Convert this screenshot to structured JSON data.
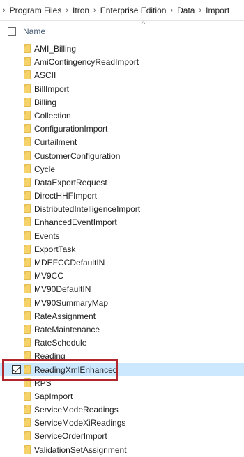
{
  "breadcrumb": {
    "items": [
      "Program Files",
      "Itron",
      "Enterprise Edition",
      "Data",
      "Import"
    ],
    "separator": "›"
  },
  "header": {
    "name_label": "Name",
    "sort_indicator": "^"
  },
  "folders": [
    {
      "label": "AMI_Billing",
      "selected": false
    },
    {
      "label": "AmiContingencyReadImport",
      "selected": false
    },
    {
      "label": "ASCII",
      "selected": false
    },
    {
      "label": "BillImport",
      "selected": false
    },
    {
      "label": "Billing",
      "selected": false
    },
    {
      "label": "Collection",
      "selected": false
    },
    {
      "label": "ConfigurationImport",
      "selected": false
    },
    {
      "label": "Curtailment",
      "selected": false
    },
    {
      "label": "CustomerConfiguration",
      "selected": false
    },
    {
      "label": "Cycle",
      "selected": false
    },
    {
      "label": "DataExportRequest",
      "selected": false
    },
    {
      "label": "DirectHHFImport",
      "selected": false
    },
    {
      "label": "DistributedIntelligenceImport",
      "selected": false
    },
    {
      "label": "EnhancedEventImport",
      "selected": false
    },
    {
      "label": "Events",
      "selected": false
    },
    {
      "label": "ExportTask",
      "selected": false
    },
    {
      "label": "MDEFCCDefaultIN",
      "selected": false
    },
    {
      "label": "MV9CC",
      "selected": false
    },
    {
      "label": "MV90DefaultIN",
      "selected": false
    },
    {
      "label": "MV90SummaryMap",
      "selected": false
    },
    {
      "label": "RateAssignment",
      "selected": false
    },
    {
      "label": "RateMaintenance",
      "selected": false
    },
    {
      "label": "RateSchedule",
      "selected": false
    },
    {
      "label": "Reading",
      "selected": false
    },
    {
      "label": "ReadingXmlEnhanced",
      "selected": true
    },
    {
      "label": "RPS",
      "selected": false
    },
    {
      "label": "SapImport",
      "selected": false
    },
    {
      "label": "ServiceModeReadings",
      "selected": false
    },
    {
      "label": "ServiceModeXiReadings",
      "selected": false
    },
    {
      "label": "ServiceOrderImport",
      "selected": false
    },
    {
      "label": "ValidationSetAssignment",
      "selected": false
    }
  ],
  "colors": {
    "selection_bg": "#cce8ff",
    "highlight_border": "#b2272d",
    "folder_fill": "#f5d36a"
  }
}
